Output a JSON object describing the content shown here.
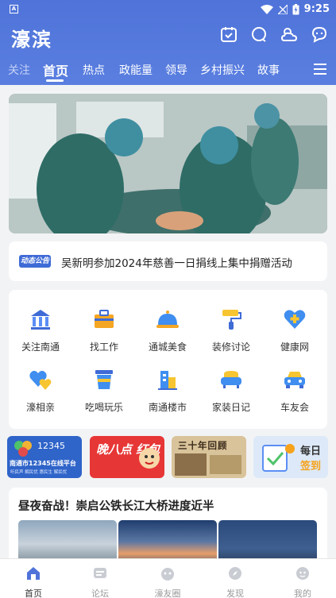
{
  "status_bar": {
    "app_badge": "A",
    "time": "9:25"
  },
  "header": {
    "title": "濠滨"
  },
  "tabs": [
    "关注",
    "首页",
    "热点",
    "政能量",
    "领导",
    "乡村振兴",
    "故事"
  ],
  "notice": {
    "badge": "动态公告",
    "text": "吴新明参加2024年慈善一日捐线上集中捐赠活动"
  },
  "grid": [
    {
      "label": "关注南通",
      "icon": "building-icon",
      "color": "#3f6bd6"
    },
    {
      "label": "找工作",
      "icon": "toolbox-icon",
      "color": "#f5a623"
    },
    {
      "label": "通城美食",
      "icon": "dish-cover-icon",
      "color": "#3f8ef0"
    },
    {
      "label": "装修讨论",
      "icon": "paint-roller-icon",
      "color": "#f7c531"
    },
    {
      "label": "健康网",
      "icon": "heart-plus-icon",
      "color": "#3f8ef0"
    },
    {
      "label": "濠相亲",
      "icon": "couple-heart-icon",
      "color": "#3f8ef0"
    },
    {
      "label": "吃喝玩乐",
      "icon": "drink-icon",
      "color": "#3f8ef0"
    },
    {
      "label": "南通楼市",
      "icon": "city-buildings-icon",
      "color": "#3f6bd6"
    },
    {
      "label": "家装日记",
      "icon": "sofa-icon",
      "color": "#f7c531"
    },
    {
      "label": "车友会",
      "icon": "car-icon",
      "color": "#3f8ef0"
    }
  ],
  "promos": {
    "p1_title": "12345",
    "p1_sub": "南通市12345在线平台",
    "p1_sub2": "听民声 解民忧 惠民生 解民忧",
    "p2_text": "晚八点 红包",
    "p3_text": "三十年回顾",
    "p4_line1": "每日",
    "p4_line2": "签到"
  },
  "news": {
    "title": "昼夜奋战！崇启公铁长江大桥进度近半"
  },
  "bottom_nav": [
    "首页",
    "论坛",
    "濠友圈",
    "发现",
    "我的"
  ],
  "colors": {
    "header": "#5478dc",
    "accent": "#3f6bd6"
  }
}
